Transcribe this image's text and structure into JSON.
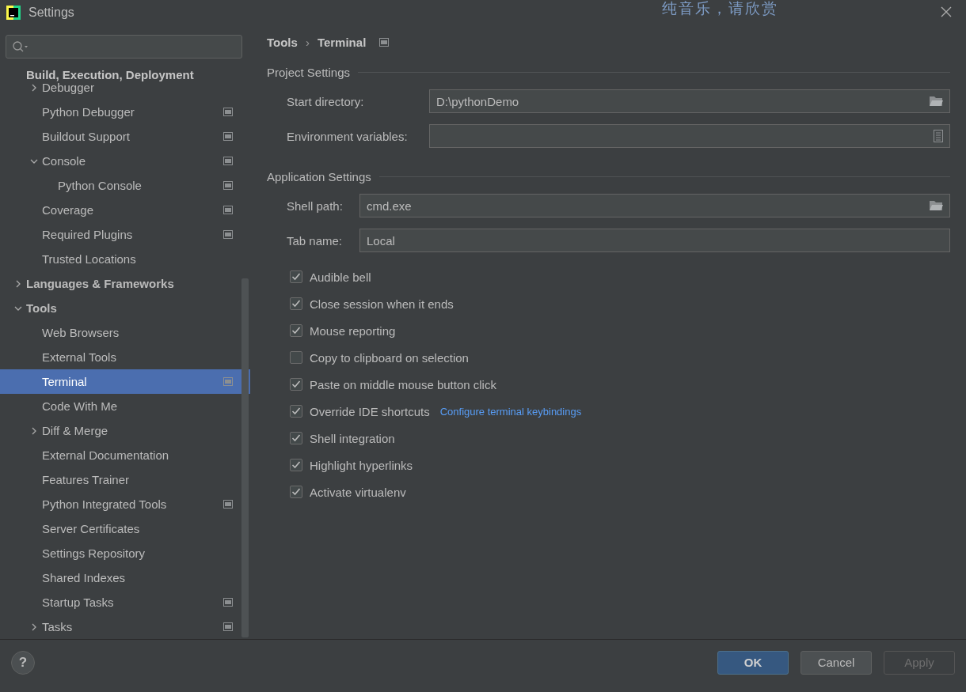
{
  "window": {
    "title": "Settings",
    "overlay_text": "纯音乐，请欣赏"
  },
  "sidebar": {
    "group_header": "Build, Execution, Deployment",
    "items": [
      {
        "label": "Debugger",
        "expanded": false,
        "selected": false,
        "project": false
      },
      {
        "label": "Python Debugger",
        "selected": false,
        "project": true
      },
      {
        "label": "Buildout Support",
        "selected": false,
        "project": true
      },
      {
        "label": "Console",
        "expanded": true,
        "selected": false,
        "project": true,
        "children": [
          {
            "label": "Python Console",
            "selected": false,
            "project": true
          }
        ]
      },
      {
        "label": "Coverage",
        "selected": false,
        "project": true
      },
      {
        "label": "Required Plugins",
        "selected": false,
        "project": true
      },
      {
        "label": "Trusted Locations",
        "selected": false,
        "project": false
      }
    ],
    "top_items": [
      {
        "label": "Languages & Frameworks",
        "expanded": false,
        "selected": false,
        "project": false
      },
      {
        "label": "Tools",
        "expanded": true,
        "selected": false,
        "project": false,
        "children": [
          {
            "label": "Web Browsers",
            "selected": false,
            "project": false
          },
          {
            "label": "External Tools",
            "selected": false,
            "project": false
          },
          {
            "label": "Terminal",
            "selected": true,
            "project": true
          },
          {
            "label": "Code With Me",
            "selected": false,
            "project": false
          },
          {
            "label": "Diff & Merge",
            "expanded": false,
            "selected": false,
            "project": false
          },
          {
            "label": "External Documentation",
            "selected": false,
            "project": false
          },
          {
            "label": "Features Trainer",
            "selected": false,
            "project": false
          },
          {
            "label": "Python Integrated Tools",
            "selected": false,
            "project": true
          },
          {
            "label": "Server Certificates",
            "selected": false,
            "project": false
          },
          {
            "label": "Settings Repository",
            "selected": false,
            "project": false
          },
          {
            "label": "Shared Indexes",
            "selected": false,
            "project": false
          },
          {
            "label": "Startup Tasks",
            "selected": false,
            "project": true
          },
          {
            "label": "Tasks",
            "expanded": false,
            "selected": false,
            "project": true
          }
        ]
      }
    ]
  },
  "breadcrumb": {
    "separator": "›",
    "items": [
      "Tools",
      "Terminal"
    ]
  },
  "sections": [
    {
      "title": "Project Settings",
      "fields": [
        {
          "label": "Start directory:",
          "value": "D:\\pythonDemo",
          "kind": "folder"
        },
        {
          "label": "Environment variables:",
          "kind": "list"
        }
      ]
    },
    {
      "title": "Application Settings",
      "fields": [
        {
          "label": "Shell path:",
          "value": "cmd.exe",
          "kind": "folder"
        },
        {
          "label": "Tab name:",
          "value": "Local",
          "kind": "text"
        }
      ],
      "options": [
        {
          "label": "Audible bell",
          "checked": true
        },
        {
          "label": "Close session when it ends",
          "checked": true
        },
        {
          "label": "Mouse reporting",
          "checked": true
        },
        {
          "label": "Copy to clipboard on selection",
          "checked": false
        },
        {
          "label": "Paste on middle mouse button click",
          "checked": true
        },
        {
          "label": "Override IDE shortcuts",
          "checked": true,
          "link": "Configure terminal keybindings"
        },
        {
          "label": "Shell integration",
          "checked": true
        },
        {
          "label": "Highlight hyperlinks",
          "checked": true
        },
        {
          "label": "Activate virtualenv",
          "checked": true
        }
      ]
    }
  ],
  "help": "?",
  "buttons": [
    {
      "label": "OK",
      "kind": "default",
      "disabled": false
    },
    {
      "label": "Cancel",
      "kind": "normal",
      "disabled": false
    },
    {
      "label": "Apply",
      "kind": "normal",
      "disabled": true
    }
  ]
}
